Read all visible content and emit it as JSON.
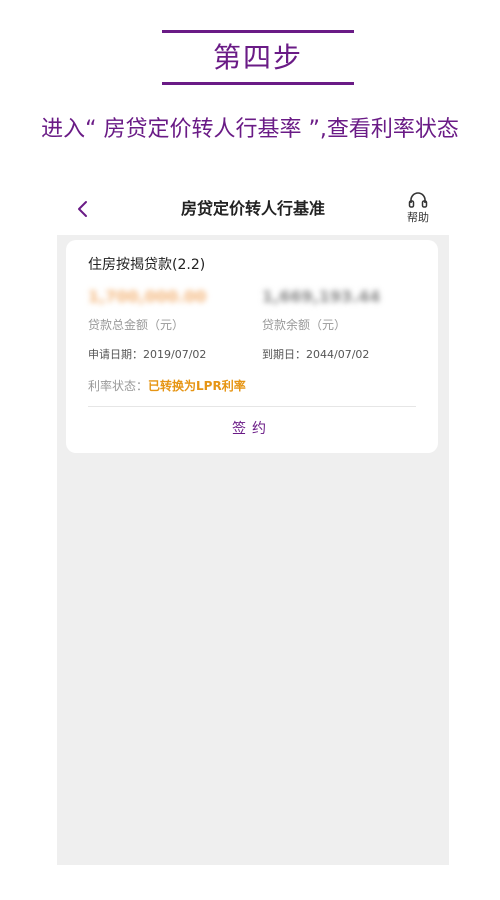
{
  "header": {
    "step_title": "第四步",
    "instruction": "进入“ 房贷定价转人行基率 ”,查看利率状态",
    "accent_color": "#6a1b86"
  },
  "app": {
    "nav": {
      "back_icon": "chevron-left-icon",
      "title": "房贷定价转人行基准",
      "help_icon": "headset-icon",
      "help_label": "帮助"
    },
    "loan_card": {
      "name": "住房按揭贷款(2.2)",
      "total_amount": "1,700,000.00",
      "total_amount_label": "贷款总金额（元）",
      "balance_amount": "1,669,193.44",
      "balance_amount_label": "贷款余额（元）",
      "apply_date_label": "申请日期：",
      "apply_date": "2019/07/02",
      "due_date_label": "到期日：",
      "due_date": "2044/07/02",
      "rate_status_label": "利率状态：",
      "rate_status_value": "已转换为LPR利率",
      "rate_status_color": "#e69514",
      "sign_button_label": "签约"
    }
  }
}
